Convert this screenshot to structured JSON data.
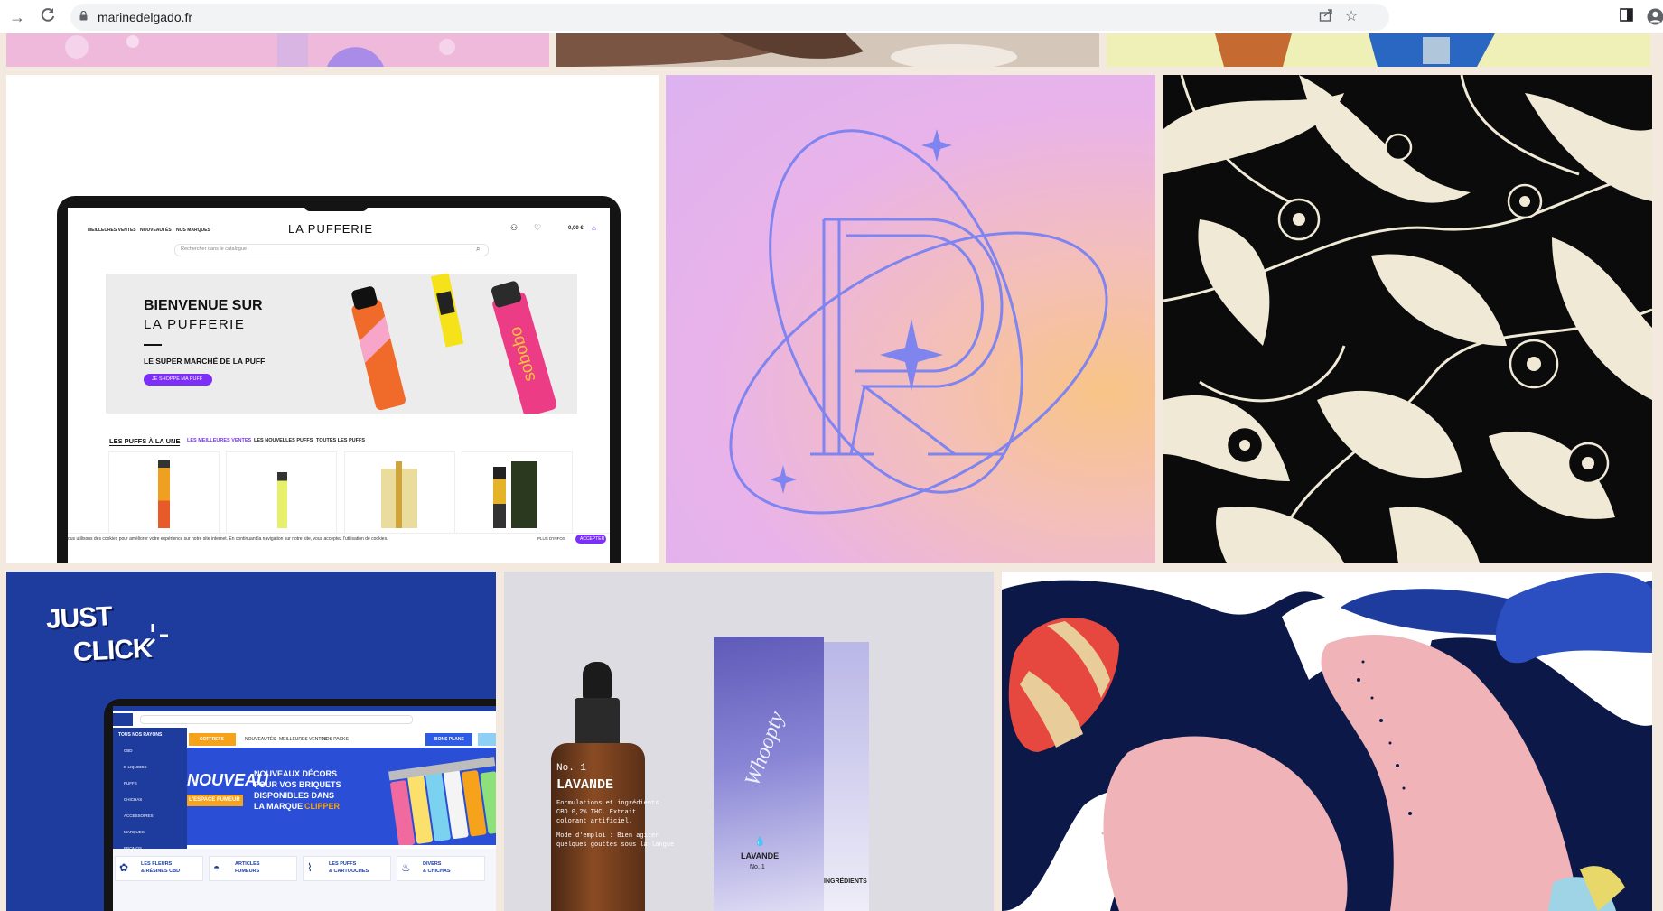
{
  "browser": {
    "url": "marinedelgado.fr"
  },
  "pufferie": {
    "nav": [
      "MEILLEURES VENTES",
      "NOUVEAUTÉS",
      "NOS MARQUES"
    ],
    "logo": "LA PUFFERIE",
    "cart": "0,00 €",
    "search_placeholder": "Rechercher dans le catalogue",
    "hero_line1": "BIENVENUE SUR",
    "hero_line2": "LA PUFFERIE",
    "hero_sub": "LE SUPER MARCHÉ DE LA PUFF",
    "hero_button": "JE SHOPPE MA PUFF",
    "tabs": [
      "LES PUFFS À LA UNE",
      "LES MEILLEURES VENTES",
      "LES NOUVELLES PUFFS",
      "TOUTES LES PUFFS"
    ],
    "cookie_text": "ous utilisons des cookies pour améliorer votre expérience sur notre site internet. En continuant la navigation sur notre site, vous acceptez l'utilisation de cookies.",
    "cookie_more": "PLUS D'INFOS",
    "cookie_accept": "ACCEPTER",
    "pen_brand": "sobobo"
  },
  "justclick": {
    "logo_line1": "JUST",
    "logo_line2": "CLICK",
    "menu_header": "TOUS NOS RAYONS",
    "menu_items": [
      "CBD",
      "E-LIQUIDES",
      "PUFFS",
      "CHICHAS",
      "ACCESSOIRES",
      "MARQUES",
      "PROMOS"
    ],
    "orange_tab": "COFFRETS",
    "nav": [
      "NOUVEAUTÉS",
      "MEILLEURES VENTES",
      "NOS PACKS"
    ],
    "blue_tab": "BONS PLANS",
    "banner_word": "NOUVEAU",
    "banner_tag": "L'ESPACE FUMEUR",
    "banner_lines": [
      "NOUVEAUX DÉCORS",
      "POUR VOS BRIQUETS",
      "DISPONIBLES DANS"
    ],
    "banner_brand_prefix": "LA MARQUE",
    "banner_brand": "CLIPPER",
    "categories": [
      {
        "line1": "LES FLEURS",
        "line2": "& RÉSINES CBD"
      },
      {
        "line1": "ARTICLES",
        "line2": "FUMEURS"
      },
      {
        "line1": "LES PUFFS",
        "line2": "& CARTOUCHES"
      },
      {
        "line1": "DIVERS",
        "line2": "& CHICHAS"
      }
    ]
  },
  "whoopty": {
    "bottle_no": "No. 1",
    "bottle_name": "LAVANDE",
    "bottle_text": [
      "Formulations et ingrédients",
      "CBD 0,2% THC. Extrait",
      "colorant artificiel.",
      "Mode d'emploi : Bien agiter",
      "quelques gouttes sous la langue"
    ],
    "box_script": "Whoopty",
    "box_name": "LAVANDE",
    "box_no": "No. 1",
    "box_side": "INGRÉDIENTS"
  },
  "colors": {
    "page_bg": "#f3e9de",
    "justclick_blue": "#1e3c9e",
    "pufferie_purple": "#7b2ff7",
    "monogram_stroke": "#7f84ee",
    "clipper_orange": "#f7a21b"
  }
}
